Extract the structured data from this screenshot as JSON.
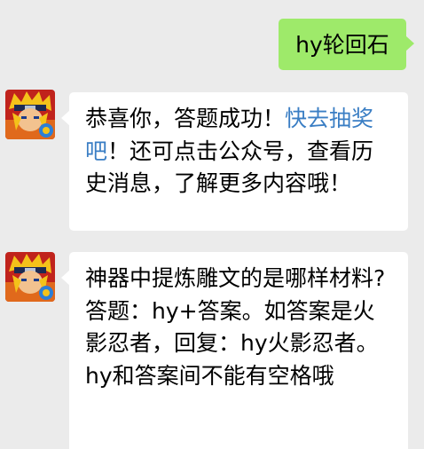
{
  "conversation": {
    "outgoing_message": "hy轮回石",
    "reply1": {
      "text_before_link": "恭喜你，答题成功！",
      "link_text": "快去抽奖吧",
      "text_after_link": "！还可点击公众号，查看历史消息，了解更多内容哦！"
    },
    "reply2": {
      "question": "神器中提炼雕文的是哪样材料?",
      "instruction": "答题：hy+答案。如答案是火影忍者，回复：hy火影忍者。hy和答案间不能有空格哦"
    }
  },
  "avatar": {
    "icon": "naruto-game-avatar-icon",
    "colors": {
      "background": "#c0231c",
      "hair": "#f4c21a",
      "headband": "#1c2a52",
      "skin": "#f2c28f",
      "badge": "#2c7fd6"
    }
  }
}
